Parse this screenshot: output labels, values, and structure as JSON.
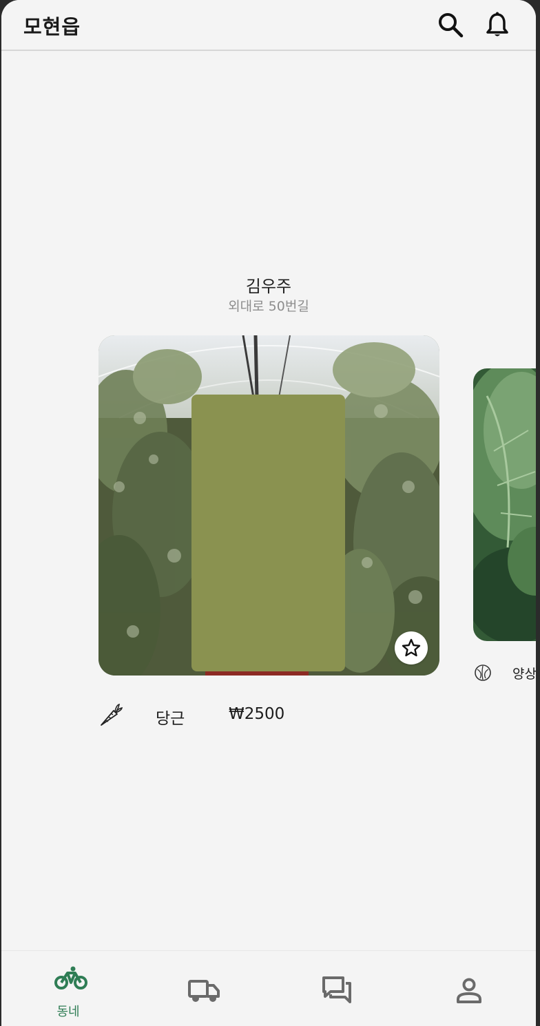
{
  "appbar": {
    "title": "모현읍",
    "search_icon": "search-icon",
    "bell_icon": "bell-icon"
  },
  "farmer": {
    "name": "김우주",
    "address": "외대로 50번길"
  },
  "products": [
    {
      "icon": "carrot-icon",
      "name": "당근",
      "price": "₩2500",
      "favorite_icon": "star-outline-icon"
    },
    {
      "icon": "cabbage-icon",
      "name": "양상"
    }
  ],
  "bottom_nav": {
    "items": [
      {
        "icon": "bicycle-icon",
        "label": "동네",
        "active": true
      },
      {
        "icon": "truck-icon",
        "label": "",
        "active": false
      },
      {
        "icon": "chat-icon",
        "label": "",
        "active": false
      },
      {
        "icon": "person-icon",
        "label": "",
        "active": false
      }
    ]
  },
  "colors": {
    "background": "#f4f4f4",
    "accent_green": "#2f7d55",
    "icon_gray": "#6a6a6a",
    "placeholder_olive": "#8a9250"
  }
}
